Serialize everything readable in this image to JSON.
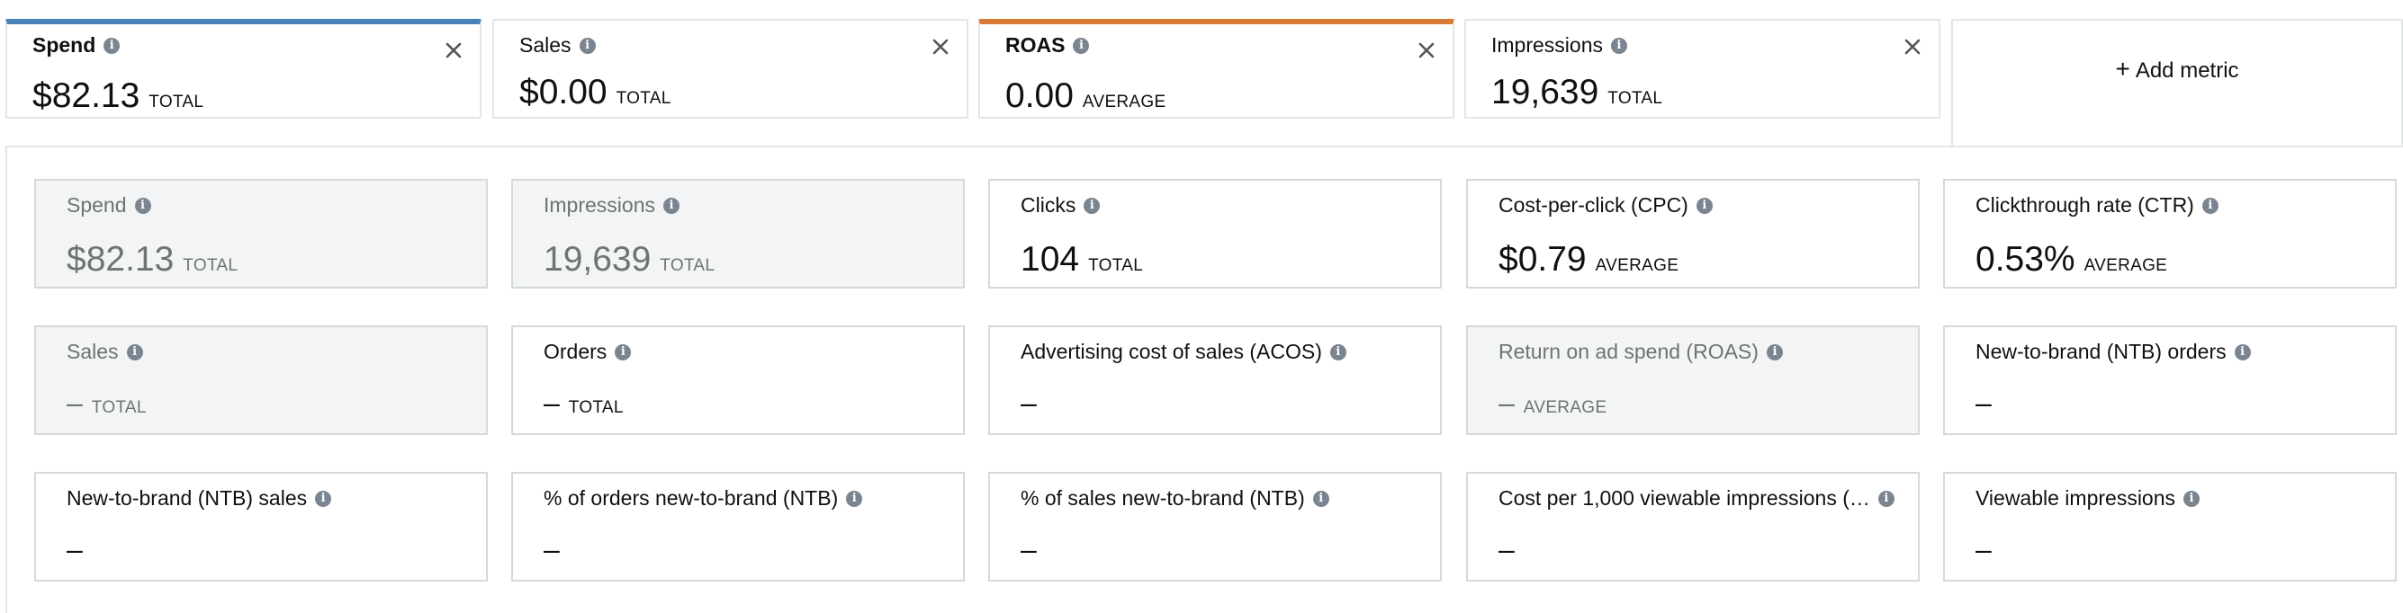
{
  "selected_metrics": [
    {
      "id": "spend",
      "title": "Spend",
      "value": "$82.13",
      "agg": "TOTAL",
      "accent": "#4a82b8"
    },
    {
      "id": "sales",
      "title": "Sales",
      "value": "$0.00",
      "agg": "TOTAL",
      "accent": null
    },
    {
      "id": "roas",
      "title": "ROAS",
      "value": "0.00",
      "agg": "AVERAGE",
      "accent": "#d97a34"
    },
    {
      "id": "impressions",
      "title": "Impressions",
      "value": "19,639",
      "agg": "TOTAL",
      "accent": null
    }
  ],
  "add_metric": {
    "plus": "+",
    "label": "Add metric"
  },
  "metric_grid": [
    [
      {
        "title": "Spend",
        "value": "$82.13",
        "agg": "TOTAL",
        "selected": true
      },
      {
        "title": "Impressions",
        "value": "19,639",
        "agg": "TOTAL",
        "selected": true
      },
      {
        "title": "Clicks",
        "value": "104",
        "agg": "TOTAL",
        "selected": false
      },
      {
        "title": "Cost-per-click (CPC)",
        "value": "$0.79",
        "agg": "AVERAGE",
        "selected": false
      },
      {
        "title": "Clickthrough rate (CTR)",
        "value": "0.53%",
        "agg": "AVERAGE",
        "selected": false
      }
    ],
    [
      {
        "title": "Sales",
        "value": "–",
        "agg": "TOTAL",
        "selected": true
      },
      {
        "title": "Orders",
        "value": "–",
        "agg": "TOTAL",
        "selected": false
      },
      {
        "title": "Advertising cost of sales (ACOS)",
        "value": "–",
        "agg": "",
        "selected": false
      },
      {
        "title": "Return on ad spend (ROAS)",
        "value": "–",
        "agg": "AVERAGE",
        "selected": true
      },
      {
        "title": "New-to-brand (NTB) orders",
        "value": "–",
        "agg": "",
        "selected": false
      }
    ],
    [
      {
        "title": "New-to-brand (NTB) sales",
        "value": "–",
        "agg": "",
        "selected": false
      },
      {
        "title": "% of orders new-to-brand (NTB)",
        "value": "–",
        "agg": "",
        "selected": false
      },
      {
        "title": "% of sales new-to-brand (NTB)",
        "value": "–",
        "agg": "",
        "selected": false
      },
      {
        "title": "Cost per 1,000 viewable impressions (…",
        "value": "–",
        "agg": "",
        "selected": false
      },
      {
        "title": "Viewable impressions",
        "value": "–",
        "agg": "",
        "selected": false
      }
    ]
  ],
  "icons": {
    "info": "info-icon",
    "close": "close-icon",
    "add": "plus-icon"
  },
  "colors": {
    "info_icon": "#7b8591",
    "selected_tile_bg": "#f2f4f6",
    "border": "#d5d9d9"
  }
}
